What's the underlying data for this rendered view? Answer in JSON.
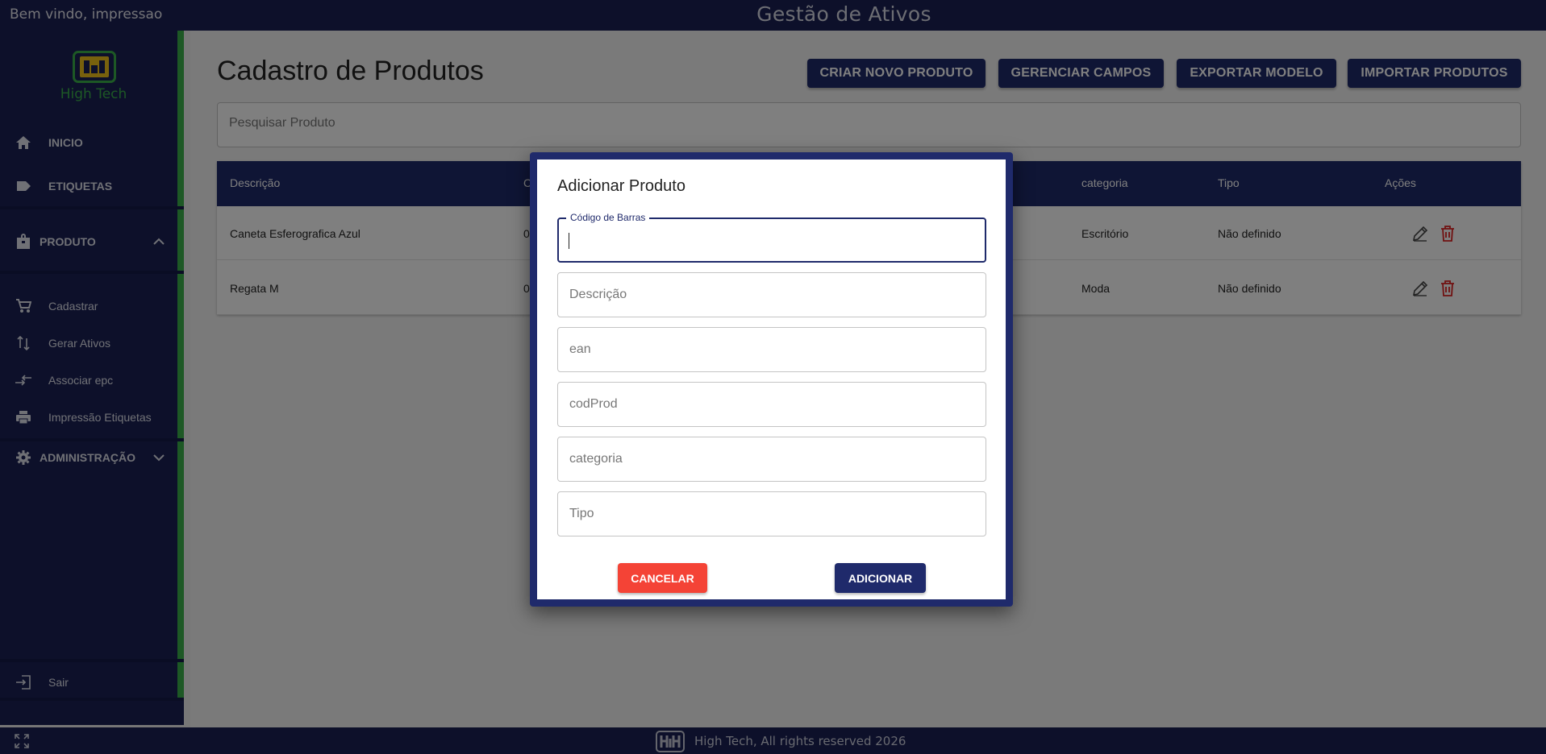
{
  "topbar": {
    "welcome": "Bem vindo, impressao",
    "title": "Gestão de Ativos"
  },
  "sidebar": {
    "logo_text": "High Tech",
    "items": [
      {
        "label": "INICIO",
        "icon": "home-icon"
      },
      {
        "label": "ETIQUETAS",
        "icon": "label-icon"
      },
      {
        "label": "PRODUTO",
        "icon": "bag-icon",
        "expanded": true
      },
      {
        "label": "Cadastrar",
        "icon": "cart-icon"
      },
      {
        "label": "Gerar Ativos",
        "icon": "swap-vertical-icon"
      },
      {
        "label": "Associar epc",
        "icon": "compare-arrows-icon"
      },
      {
        "label": "Impressão Etiquetas",
        "icon": "printer-icon"
      },
      {
        "label": "ADMINISTRAÇÃO",
        "icon": "gear-icon",
        "expanded": false
      }
    ],
    "logout": "Sair"
  },
  "main": {
    "title": "Cadastro de Produtos",
    "buttons": {
      "create": "CRIAR NOVO PRODUTO",
      "manage": "GERENCIAR CAMPOS",
      "export": "EXPORTAR MODELO",
      "import": "IMPORTAR PRODUTOS"
    },
    "search_placeholder": "Pesquisar Produto",
    "table": {
      "headers": [
        "Descrição",
        "C",
        "categoria",
        "Tipo",
        "Ações"
      ],
      "rows": [
        {
          "descricao": "Caneta Esferografica Azul",
          "c": "0",
          "categoria": "Escritório",
          "tipo": "Não definido"
        },
        {
          "descricao": "Regata M",
          "c": "0",
          "categoria": "Moda",
          "tipo": "Não definido"
        }
      ]
    }
  },
  "modal": {
    "title": "Adicionar Produto",
    "fields": {
      "barcode_label": "Código de Barras",
      "barcode_value": "",
      "descricao": "Descrição",
      "ean": "ean",
      "codprod": "codProd",
      "categoria": "categoria",
      "tipo": "Tipo"
    },
    "cancel": "CANCELAR",
    "add": "ADICIONAR",
    "colors": {
      "primary": "#1f2a6b",
      "cancel": "#f44336"
    }
  },
  "footer": {
    "text": "High Tech, All rights reserved 2026"
  }
}
